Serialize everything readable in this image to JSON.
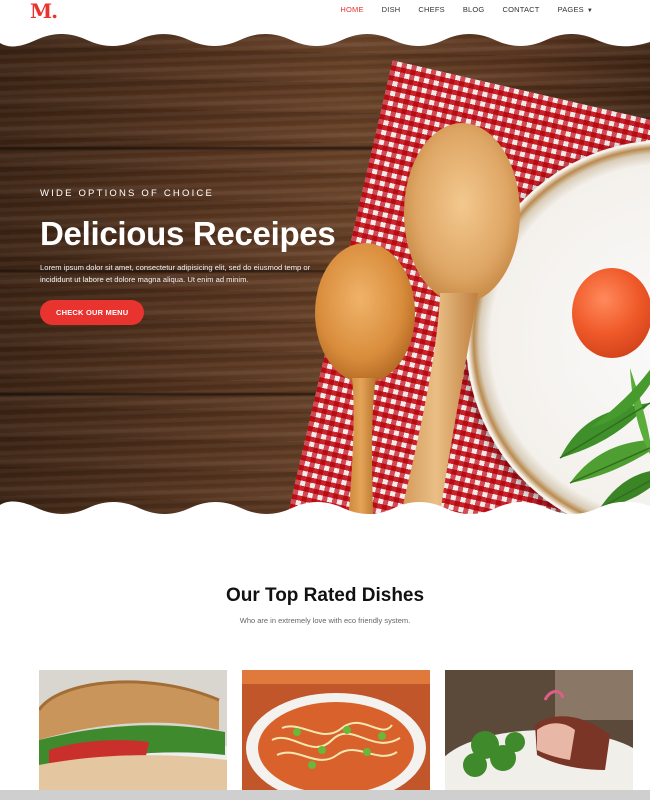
{
  "brand": {
    "logo_text": "M."
  },
  "nav": {
    "items": [
      {
        "label": "HOME",
        "active": true
      },
      {
        "label": "DISH",
        "active": false
      },
      {
        "label": "CHEFS",
        "active": false
      },
      {
        "label": "BLOG",
        "active": false
      },
      {
        "label": "CONTACT",
        "active": false
      },
      {
        "label": "PAGES",
        "active": false,
        "has_dropdown": true
      }
    ]
  },
  "hero": {
    "eyebrow": "WIDE OPTIONS OF CHOICE",
    "title": "Delicious Receipes",
    "text": "Lorem ipsum dolor sit amet, consectetur adipisicing elit, sed do eiusmod temp or incididunt ut labore et dolore magna aliqua. Ut enim ad minim.",
    "cta_label": "CHECK OUR MENU"
  },
  "section": {
    "title": "Our Top Rated Dishes",
    "subtitle": "Who are in extremely love with eco friendly system."
  },
  "colors": {
    "accent": "#e8332f",
    "text": "#222222"
  }
}
